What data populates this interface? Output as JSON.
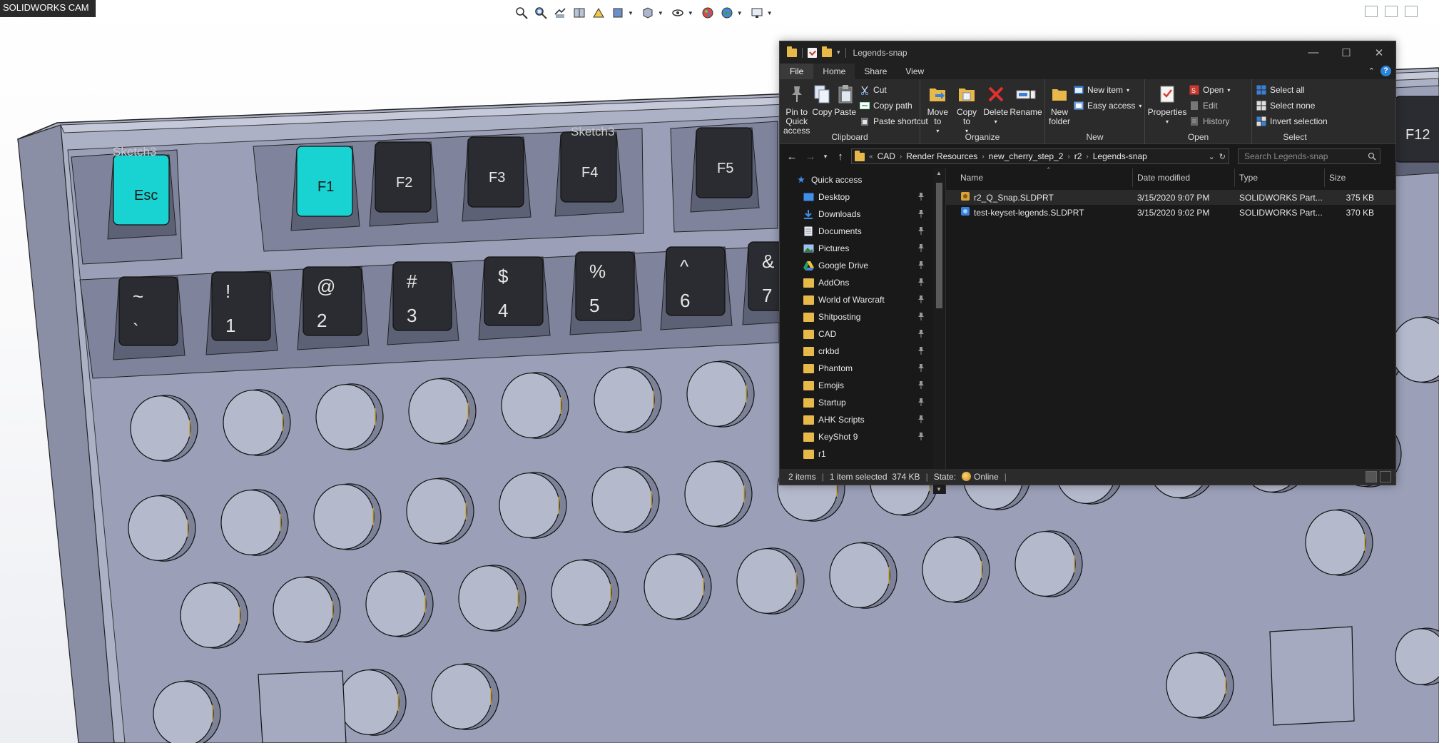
{
  "viewport": {
    "app_tag": "SOLIDWORKS CAM",
    "toolbar_icons": [
      "zoom-fit-icon",
      "zoom-area-icon",
      "previous-view-icon",
      "section-view-icon",
      "dynamic-annotation-icon",
      "view-orientation-icon",
      "display-style-icon",
      "hide-show-icon",
      "edit-appearance-icon",
      "apply-scene-icon",
      "view-settings-icon"
    ],
    "sketch_labels": [
      "Sketch3",
      "Sketch3"
    ],
    "keys_row1": [
      "Esc",
      "F1",
      "F2",
      "F3",
      "F4",
      "F5",
      "F12"
    ],
    "keys_row2": [
      {
        "top": "~",
        "bottom": "`"
      },
      {
        "top": "!",
        "bottom": "1"
      },
      {
        "top": "@",
        "bottom": "2"
      },
      {
        "top": "#",
        "bottom": "3"
      },
      {
        "top": "$",
        "bottom": "4"
      },
      {
        "top": "%",
        "bottom": "5"
      },
      {
        "top": "^",
        "bottom": "6"
      },
      {
        "top": "&",
        "bottom": "7"
      }
    ],
    "highlight_color": "#19d3d3",
    "plate_color": "#9ba0b8"
  },
  "explorer": {
    "title": "Legends-snap",
    "tabs": [
      "File",
      "Home",
      "Share",
      "View"
    ],
    "active_tab": "Home",
    "ribbon": {
      "clipboard": {
        "label": "Clipboard",
        "pin": "Pin to Quick access",
        "copy": "Copy",
        "paste": "Paste",
        "cut": "Cut",
        "copy_path": "Copy path",
        "paste_shortcut": "Paste shortcut"
      },
      "organize": {
        "label": "Organize",
        "move_to": "Move to",
        "copy_to": "Copy to",
        "delete": "Delete",
        "rename": "Rename"
      },
      "new": {
        "label": "New",
        "new_folder": "New folder",
        "new_item": "New item",
        "easy_access": "Easy access"
      },
      "open": {
        "label": "Open",
        "properties": "Properties",
        "open": "Open",
        "edit": "Edit",
        "history": "History"
      },
      "select": {
        "label": "Select",
        "select_all": "Select all",
        "select_none": "Select none",
        "invert_selection": "Invert selection"
      }
    },
    "address": {
      "crumbs": [
        "CAD",
        "Render Resources",
        "new_cherry_step_2",
        "r2",
        "Legends-snap"
      ],
      "search_placeholder": "Search Legends-snap"
    },
    "nav": {
      "quick_access": "Quick access",
      "items": [
        {
          "label": "Desktop",
          "icon": "desktop-icon",
          "pinned": true
        },
        {
          "label": "Downloads",
          "icon": "downloads-icon",
          "pinned": true
        },
        {
          "label": "Documents",
          "icon": "documents-icon",
          "pinned": true
        },
        {
          "label": "Pictures",
          "icon": "pictures-icon",
          "pinned": true
        },
        {
          "label": "Google Drive",
          "icon": "google-drive-icon",
          "pinned": true
        },
        {
          "label": "AddOns",
          "icon": "folder-icon",
          "pinned": true
        },
        {
          "label": "World of Warcraft",
          "icon": "folder-icon",
          "pinned": true
        },
        {
          "label": "Shitposting",
          "icon": "folder-icon",
          "pinned": true
        },
        {
          "label": "CAD",
          "icon": "folder-icon",
          "pinned": true
        },
        {
          "label": "crkbd",
          "icon": "folder-icon",
          "pinned": true
        },
        {
          "label": "Phantom",
          "icon": "folder-icon",
          "pinned": true
        },
        {
          "label": "Emojis",
          "icon": "folder-icon",
          "pinned": true
        },
        {
          "label": "Startup",
          "icon": "folder-icon",
          "pinned": true
        },
        {
          "label": "AHK Scripts",
          "icon": "folder-icon",
          "pinned": true
        },
        {
          "label": "KeyShot 9",
          "icon": "folder-icon",
          "pinned": true
        },
        {
          "label": "r1",
          "icon": "folder-icon",
          "pinned": false
        }
      ]
    },
    "columns": {
      "name": "Name",
      "date": "Date modified",
      "type": "Type",
      "size": "Size"
    },
    "files": [
      {
        "name": "r2_Q_Snap.SLDPRT",
        "date": "3/15/2020 9:07 PM",
        "type": "SOLIDWORKS Part...",
        "size": "375 KB",
        "selected": true
      },
      {
        "name": "test-keyset-legends.SLDPRT",
        "date": "3/15/2020 9:02 PM",
        "type": "SOLIDWORKS Part...",
        "size": "370 KB",
        "selected": false
      }
    ],
    "status": {
      "items": "2 items",
      "selected": "1 item selected  374 KB",
      "state_label": "State:",
      "state_value": "Online"
    }
  }
}
